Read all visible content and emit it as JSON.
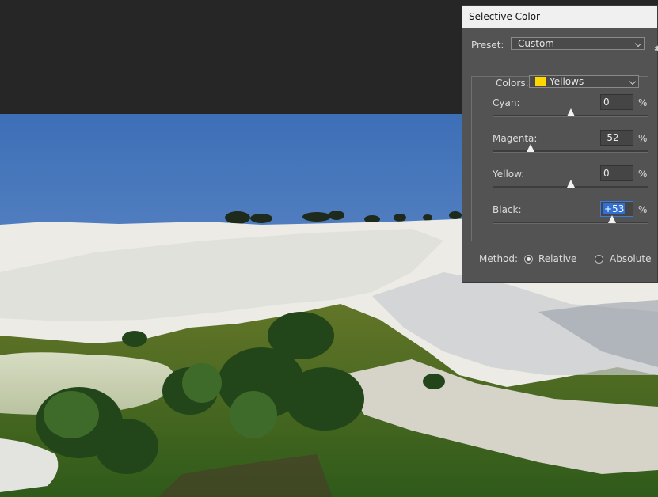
{
  "dialog": {
    "title": "Selective Color",
    "preset_label": "Preset:",
    "preset_value": "Custom",
    "colors_label": "Colors:",
    "colors_value": "Yellows",
    "colors_swatch": "#ffd800",
    "sliders": [
      {
        "label": "Cyan:",
        "value": "0",
        "unit": "%",
        "fraction": 0.5
      },
      {
        "label": "Magenta:",
        "value": "-52",
        "unit": "%",
        "fraction": 0.24
      },
      {
        "label": "Yellow:",
        "value": "0",
        "unit": "%",
        "fraction": 0.5
      },
      {
        "label": "Black:",
        "value": "+53",
        "unit": "%",
        "fraction": 0.765
      }
    ],
    "method_label": "Method:",
    "method_options": [
      "Relative",
      "Absolute"
    ],
    "method_selected": "Relative"
  },
  "colors": {
    "accent": "#2f6fd6",
    "app_background": "#262626",
    "panel": "#535353"
  }
}
